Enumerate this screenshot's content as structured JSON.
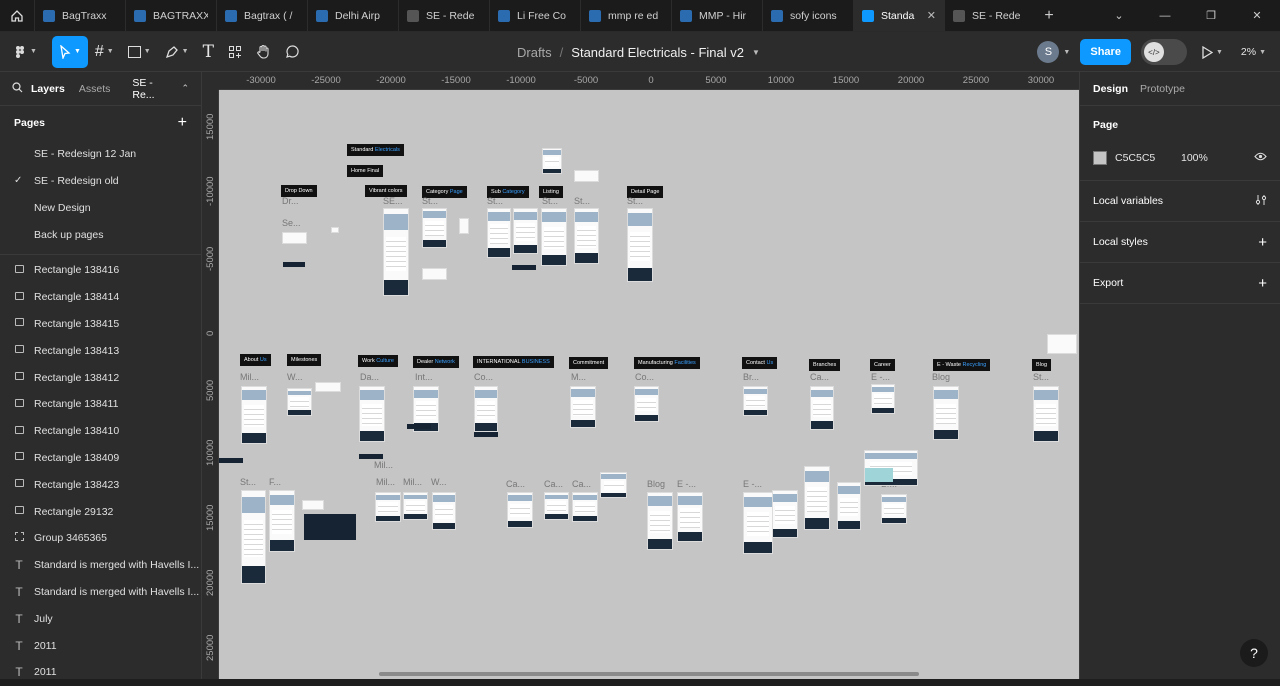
{
  "tabs": [
    {
      "label": "BagTraxx",
      "color": "#2b6cb0"
    },
    {
      "label": "BAGTRAXX",
      "color": "#2b6cb0"
    },
    {
      "label": "Bagtrax ( /",
      "color": "#2b6cb0"
    },
    {
      "label": "Delhi Airp",
      "color": "#2b6cb0"
    },
    {
      "label": "SE - Rede",
      "color": "#555555"
    },
    {
      "label": "Li Free Co",
      "color": "#2b6cb0"
    },
    {
      "label": "mmp re ed",
      "color": "#2b6cb0"
    },
    {
      "label": "MMP - Hir",
      "color": "#2b6cb0"
    },
    {
      "label": "sofy icons",
      "color": "#2b6cb0"
    },
    {
      "label": "Standa",
      "color": "#0d99ff",
      "active": true
    },
    {
      "label": "SE - Rede",
      "color": "#555555"
    }
  ],
  "toolbar": {
    "breadcrumb_drafts": "Drafts",
    "breadcrumb_sep": "/",
    "file_name": "Standard Electricals - Final v2",
    "avatar_initial": "S",
    "share_label": "Share",
    "zoom_label": "2%"
  },
  "left_panel": {
    "tab_layers": "Layers",
    "tab_assets": "Assets",
    "page_switch": "SE - Re...",
    "pages_title": "Pages",
    "pages": [
      {
        "label": "SE - Redesign 12 Jan",
        "current": false
      },
      {
        "label": "SE - Redesign old",
        "current": true
      },
      {
        "label": "New Design",
        "current": false
      },
      {
        "label": "Back up pages",
        "current": false
      }
    ],
    "layers": [
      {
        "label": "Rectangle 138416",
        "kind": "rect"
      },
      {
        "label": "Rectangle 138414",
        "kind": "rect"
      },
      {
        "label": "Rectangle 138415",
        "kind": "rect"
      },
      {
        "label": "Rectangle 138413",
        "kind": "rect"
      },
      {
        "label": "Rectangle 138412",
        "kind": "rect"
      },
      {
        "label": "Rectangle 138411",
        "kind": "rect"
      },
      {
        "label": "Rectangle 138410",
        "kind": "rect"
      },
      {
        "label": "Rectangle 138409",
        "kind": "rect"
      },
      {
        "label": "Rectangle 138423",
        "kind": "rect"
      },
      {
        "label": "Rectangle 29132",
        "kind": "rect"
      },
      {
        "label": "Group 3465365",
        "kind": "group"
      },
      {
        "label": "Standard is merged with Havells I...",
        "kind": "text"
      },
      {
        "label": "Standard is merged with Havells I...",
        "kind": "text"
      },
      {
        "label": "July",
        "kind": "text"
      },
      {
        "label": "2011",
        "kind": "text"
      },
      {
        "label": "2011",
        "kind": "text"
      }
    ]
  },
  "rulers": {
    "x_ticks": [
      "-30000",
      "-25000",
      "-20000",
      "-15000",
      "-10000",
      "-5000",
      "0",
      "5000",
      "10000",
      "15000",
      "20000",
      "25000",
      "30000"
    ],
    "y_ticks": [
      "15000",
      "-10000",
      "-5000",
      "0",
      "5000",
      "10000",
      "15000",
      "20000",
      "25000"
    ]
  },
  "canvas": {
    "background": "#C5C5C5",
    "labels": [
      {
        "text": "Standard ",
        "accent": "Electricals"
      },
      {
        "text": "Home Final",
        "accent": ""
      },
      {
        "text": "Drop Down",
        "accent": ""
      },
      {
        "text": "Vibrant colors",
        "accent": ""
      },
      {
        "text": "Category ",
        "accent": "Page"
      },
      {
        "text": "Sub ",
        "accent": "Category"
      },
      {
        "text": "Listing",
        "accent": ""
      },
      {
        "text": "Detail Page",
        "accent": ""
      },
      {
        "text": "About ",
        "accent": "Us"
      },
      {
        "text": "Milestones",
        "accent": ""
      },
      {
        "text": "Work ",
        "accent": "Culture"
      },
      {
        "text": "Dealer ",
        "accent": "Network"
      },
      {
        "text": "INTERNATIONAL ",
        "accent": "BUSINESS"
      },
      {
        "text": "Commitment",
        "accent": ""
      },
      {
        "text": "Manufacturing ",
        "accent": "Facilities"
      },
      {
        "text": "Contact ",
        "accent": "Us"
      },
      {
        "text": "Branches",
        "accent": ""
      },
      {
        "text": "Career",
        "accent": ""
      },
      {
        "text": "E - Waste ",
        "accent": "Recycling"
      },
      {
        "text": "Blog",
        "accent": ""
      }
    ],
    "frame_names": [
      "Dr...",
      "Se...",
      "SE...",
      "St...",
      "St...",
      "St...",
      "St...",
      "St...",
      "Mil...",
      "W...",
      "Da...",
      "Int...",
      "Co...",
      "M...",
      "Co...",
      "Br...",
      "Ca...",
      "E -...",
      "Blog",
      "St...",
      "St...",
      "F...",
      "Mil...",
      "Mil...",
      "Mil...",
      "W...",
      "Ca...",
      "Ca...",
      "Ca...",
      "Blog",
      "Blog",
      "E -...",
      "E -...",
      "Br..."
    ]
  },
  "right_panel": {
    "tab_design": "Design",
    "tab_prototype": "Prototype",
    "page_section": "Page",
    "page_color": "C5C5C5",
    "page_opacity": "100%",
    "local_variables": "Local variables",
    "local_styles": "Local styles",
    "export": "Export",
    "help": "?"
  }
}
